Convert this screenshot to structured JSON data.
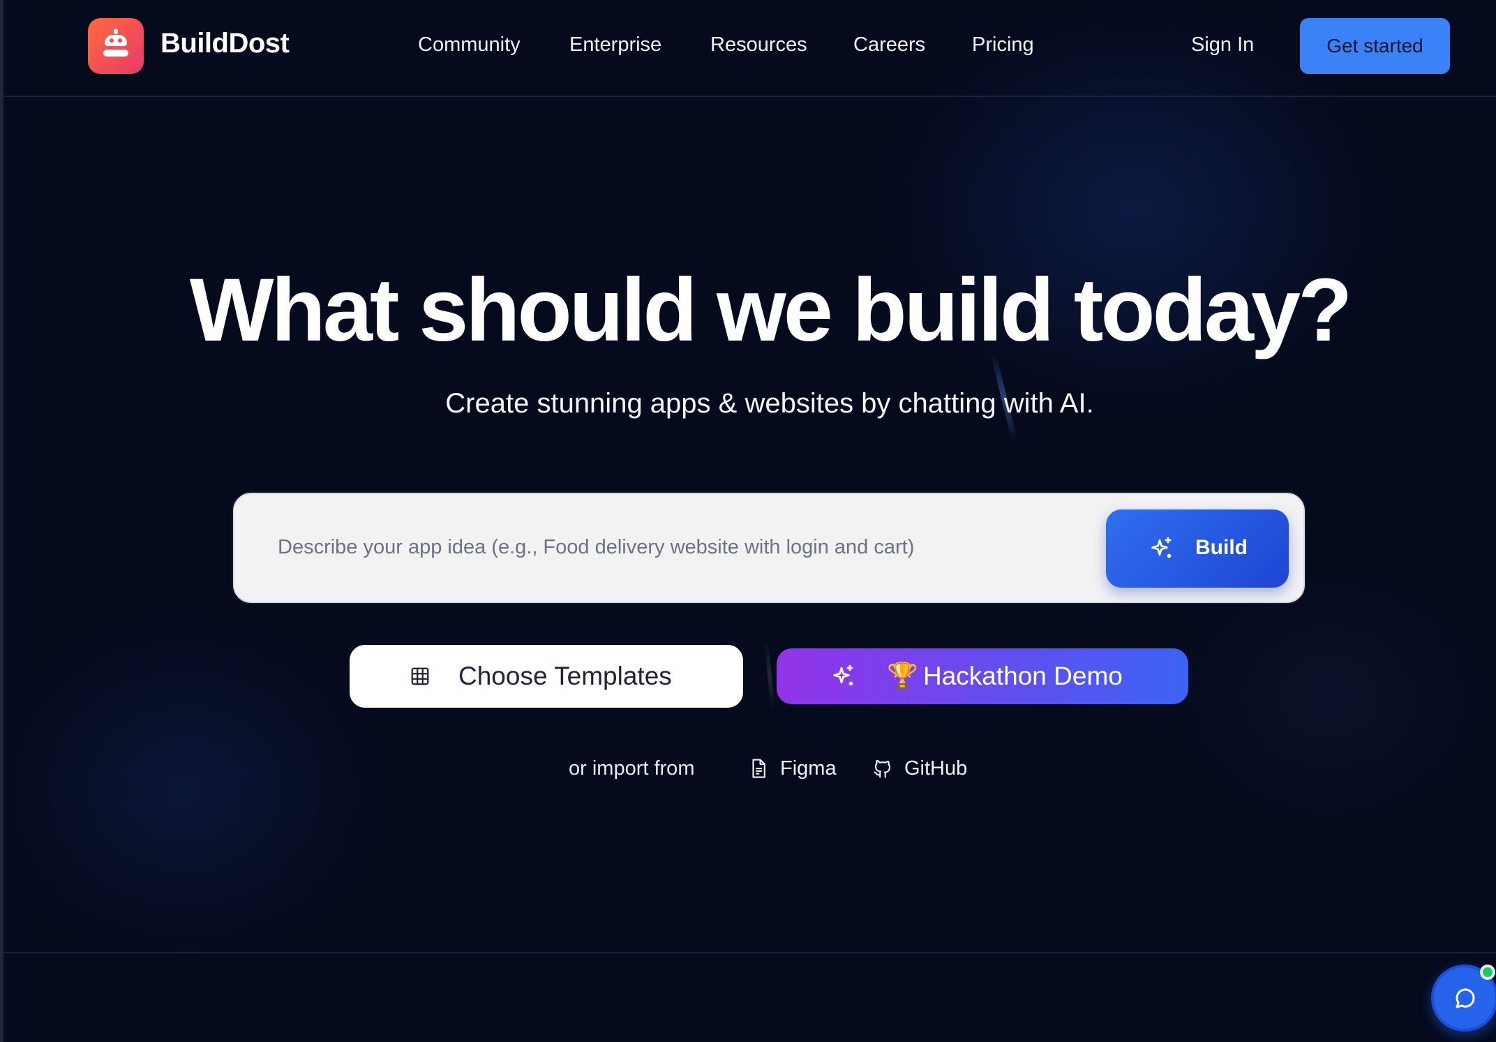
{
  "header": {
    "brand": "BuildDost",
    "logo_icon": "robot-icon",
    "nav": [
      {
        "label": "Community"
      },
      {
        "label": "Enterprise"
      },
      {
        "label": "Resources"
      },
      {
        "label": "Careers"
      },
      {
        "label": "Pricing"
      }
    ],
    "sign_in": "Sign In",
    "get_started": "Get started"
  },
  "hero": {
    "title": "What should we build today?",
    "subtitle": "Create stunning apps & websites by chatting with AI."
  },
  "prompt": {
    "placeholder": "Describe your app idea (e.g., Food delivery website with login and cart)",
    "value": "",
    "build_label": "Build",
    "build_icon": "sparkles-icon"
  },
  "actions": {
    "templates_label": "Choose Templates",
    "templates_icon": "grid-icon",
    "hackathon_label": "Hackathon Demo",
    "hackathon_emoji": "🏆",
    "hackathon_icon": "sparkles-icon"
  },
  "import": {
    "label": "or import from",
    "figma": "Figma",
    "figma_icon": "file-icon",
    "github": "GitHub",
    "github_icon": "github-icon"
  },
  "chat": {
    "icon": "chat-bubble-icon",
    "status_color": "#22c55e"
  },
  "colors": {
    "background": "#050a1c",
    "accent_blue": "#3b82f6",
    "build_blue": "#1e45d4",
    "hack_purple": "#9333ea",
    "logo_orange": "#ff6a3d"
  }
}
